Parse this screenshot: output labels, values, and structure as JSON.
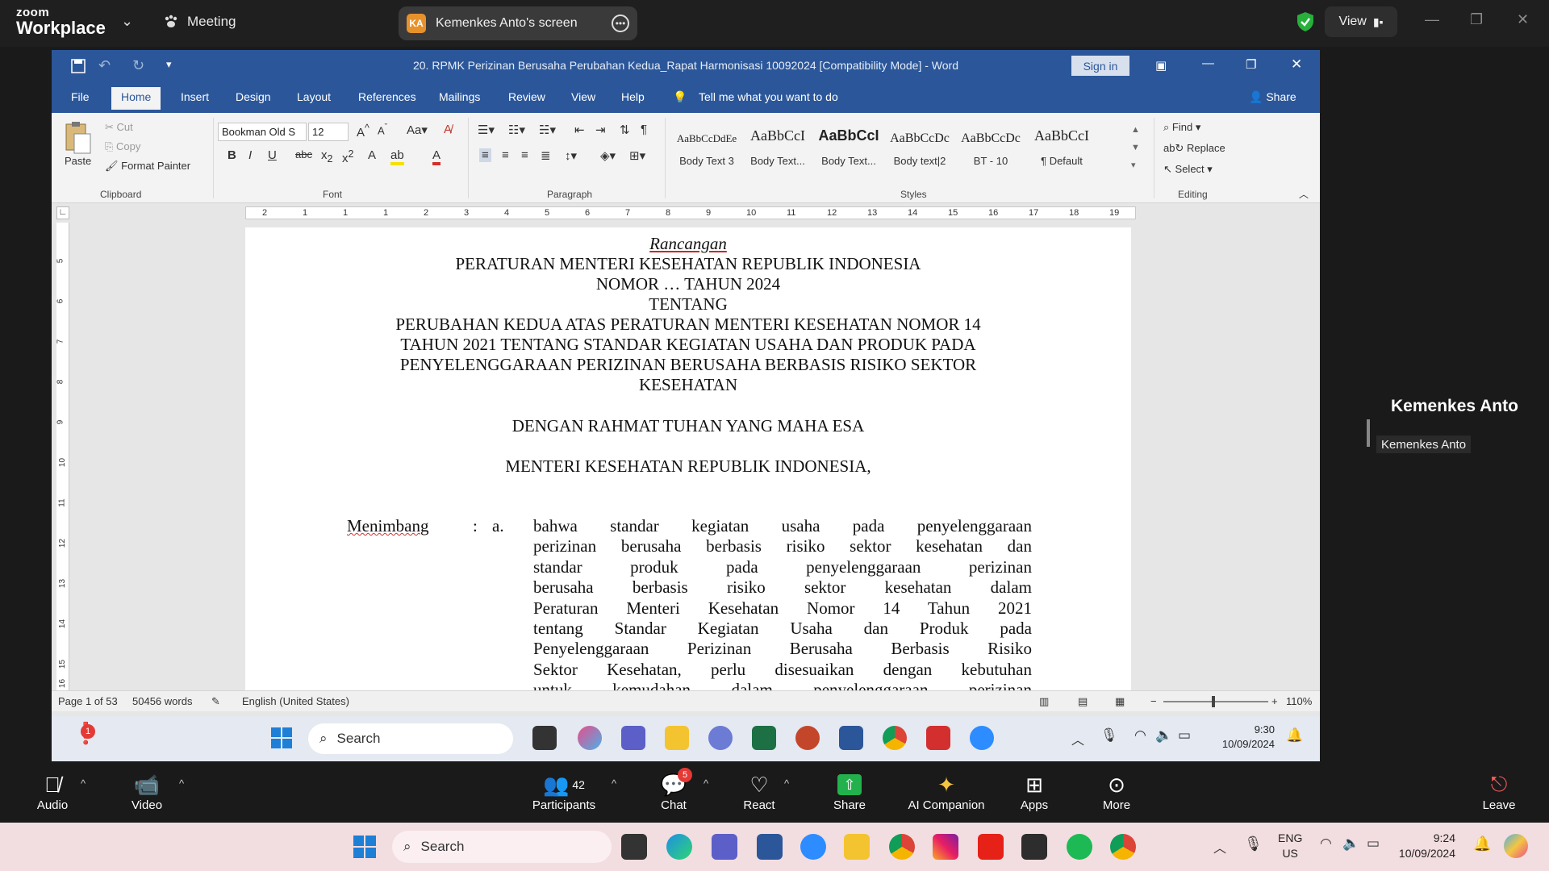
{
  "zoom": {
    "logo_top": "zoom",
    "logo_bottom": "Workplace",
    "meeting_label": "Meeting",
    "share_initials": "KA",
    "share_label": "Kemenkes Anto's screen",
    "view_label": "View",
    "audio_label": "Audio",
    "video_label": "Video",
    "participants_label": "Participants",
    "participants_count": "42",
    "chat_label": "Chat",
    "chat_badge": "5",
    "react_label": "React",
    "share_btn_label": "Share",
    "ai_label": "AI Companion",
    "apps_label": "Apps",
    "more_label": "More",
    "leave_label": "Leave",
    "notify_badge": "1"
  },
  "tile": {
    "name": "Kemenkes Anto",
    "tag": "Kemenkes Anto"
  },
  "word": {
    "title": "20. RPMK Perizinan Berusaha Perubahan Kedua_Rapat Harmonisasi 10092024 [Compatibility Mode]  -  Word",
    "sign_in": "Sign in",
    "tabs": [
      "File",
      "Home",
      "Insert",
      "Design",
      "Layout",
      "References",
      "Mailings",
      "Review",
      "View",
      "Help"
    ],
    "tell_me": "Tell me what you want to do",
    "share": "Share",
    "clipboard": {
      "paste": "Paste",
      "cut": "Cut",
      "copy": "Copy",
      "format_painter": "Format Painter",
      "group": "Clipboard"
    },
    "font": {
      "name": "Bookman Old S",
      "size": "12",
      "group": "Font"
    },
    "paragraph_group": "Paragraph",
    "styles": {
      "group": "Styles",
      "items": [
        {
          "preview": "AaBbCcDdEe",
          "name": "Body Text 3"
        },
        {
          "preview": "AaBbCcI",
          "name": "Body Text..."
        },
        {
          "preview": "AaBbCcI",
          "name": "Body Text..."
        },
        {
          "preview": "AaBbCcDc",
          "name": "Body text|2"
        },
        {
          "preview": "AaBbCcDc",
          "name": "BT - 10"
        },
        {
          "preview": "AaBbCcI",
          "name": "¶ Default"
        }
      ]
    },
    "editing": {
      "find": "Find",
      "replace": "Replace",
      "select": "Select",
      "group": "Editing"
    },
    "ruler_numbers": [
      "2",
      "1",
      "1",
      "1",
      "2",
      "3",
      "4",
      "5",
      "6",
      "7",
      "8",
      "9",
      "10",
      "11",
      "12",
      "13",
      "14",
      "15",
      "16",
      "17",
      "18",
      "19"
    ],
    "vruler_numbers": [
      "5",
      "6",
      "7",
      "8",
      "9",
      "10",
      "11",
      "12",
      "13",
      "14",
      "15",
      "16"
    ],
    "doc": {
      "rancangan": "Rancangan",
      "line1": "PERATURAN MENTERI KESEHATAN REPUBLIK INDONESIA",
      "line2": "NOMOR … TAHUN 2024",
      "line3": "TENTANG",
      "line4": "PERUBAHAN KEDUA ATAS PERATURAN MENTERI KESEHATAN NOMOR 14",
      "line5": "TAHUN 2021 TENTANG STANDAR KEGIATAN USAHA DAN PRODUK PADA",
      "line6": "PENYELENGGARAAN PERIZINAN BERUSAHA BERBASIS RISIKO SEKTOR",
      "line7": "KESEHATAN",
      "line8": "DENGAN RAHMAT TUHAN YANG MAHA ESA",
      "line9": "MENTERI KESEHATAN REPUBLIK INDONESIA,",
      "menimbang": "Menimbang",
      "colon": ":",
      "point": "a.",
      "body_lines": [
        "bahwa standar kegiatan usaha pada penyelenggaraan",
        "perizinan berusaha berbasis risiko sektor kesehatan dan",
        "standar produk pada penyelenggaraan perizinan",
        "berusaha berbasis risiko sektor kesehatan dalam",
        "Peraturan Menteri Kesehatan Nomor 14 Tahun 2021",
        "tentang Standar Kegiatan Usaha dan Produk pada",
        "Penyelenggaraan Perizinan Berusaha Berbasis Risiko",
        "Sektor Kesehatan, perlu disesuaikan dengan kebutuhan",
        "untuk kemudahan dalam penyelenggaraan perizinan"
      ]
    },
    "status": {
      "page": "Page 1 of 53",
      "words": "50456 words",
      "language": "English (United States)",
      "zoom": "110%"
    }
  },
  "remote_taskbar": {
    "search": "Search",
    "time": "9:30",
    "date": "10/09/2024"
  },
  "host_taskbar": {
    "search": "Search",
    "lang1": "ENG",
    "lang2": "US",
    "time": "9:24",
    "date": "10/09/2024"
  },
  "colors": {
    "word_blue": "#2b579a",
    "zoom_bg": "#1a1a1a",
    "host_taskbar": "#f2dde0"
  }
}
